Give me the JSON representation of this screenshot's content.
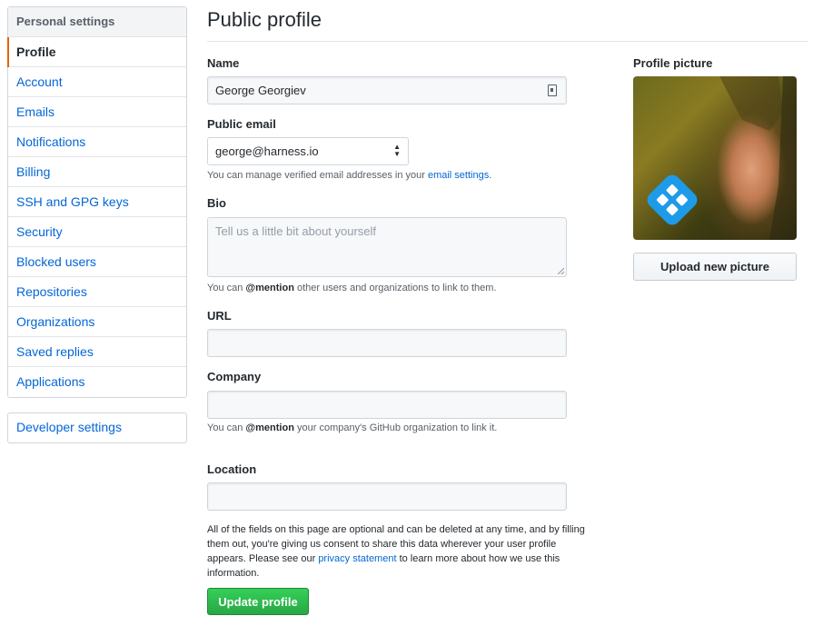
{
  "sidebar": {
    "heading": "Personal settings",
    "items": [
      {
        "label": "Profile"
      },
      {
        "label": "Account"
      },
      {
        "label": "Emails"
      },
      {
        "label": "Notifications"
      },
      {
        "label": "Billing"
      },
      {
        "label": "SSH and GPG keys"
      },
      {
        "label": "Security"
      },
      {
        "label": "Blocked users"
      },
      {
        "label": "Repositories"
      },
      {
        "label": "Organizations"
      },
      {
        "label": "Saved replies"
      },
      {
        "label": "Applications"
      }
    ],
    "developer_settings": "Developer settings"
  },
  "main": {
    "title": "Public profile",
    "name": {
      "label": "Name",
      "value": "George Georgiev"
    },
    "public_email": {
      "label": "Public email",
      "selected": "george@harness.io",
      "note_prefix": "You can manage verified email addresses in your ",
      "note_link": "email settings",
      "note_suffix": "."
    },
    "bio": {
      "label": "Bio",
      "placeholder": "Tell us a little bit about yourself",
      "note_prefix": "You can ",
      "note_mention": "@mention",
      "note_suffix": " other users and organizations to link to them."
    },
    "url": {
      "label": "URL",
      "value": ""
    },
    "company": {
      "label": "Company",
      "value": "",
      "note_prefix": "You can ",
      "note_mention": "@mention",
      "note_suffix": " your company's GitHub organization to link it."
    },
    "location": {
      "label": "Location",
      "value": ""
    },
    "disclaimer": {
      "prefix": "All of the fields on this page are optional and can be deleted at any time, and by filling them out, you're giving us consent to share this data wherever your user profile appears. Please see our ",
      "link": "privacy statement",
      "suffix": " to learn more about how we use this information."
    },
    "update_button": "Update profile"
  },
  "profile_picture": {
    "label": "Profile picture",
    "upload_button": "Upload new picture"
  },
  "colors": {
    "link": "#0366d6",
    "selected_accent": "#e36209",
    "primary_button": "#28a745",
    "logo_blue": "#1e9be8"
  }
}
